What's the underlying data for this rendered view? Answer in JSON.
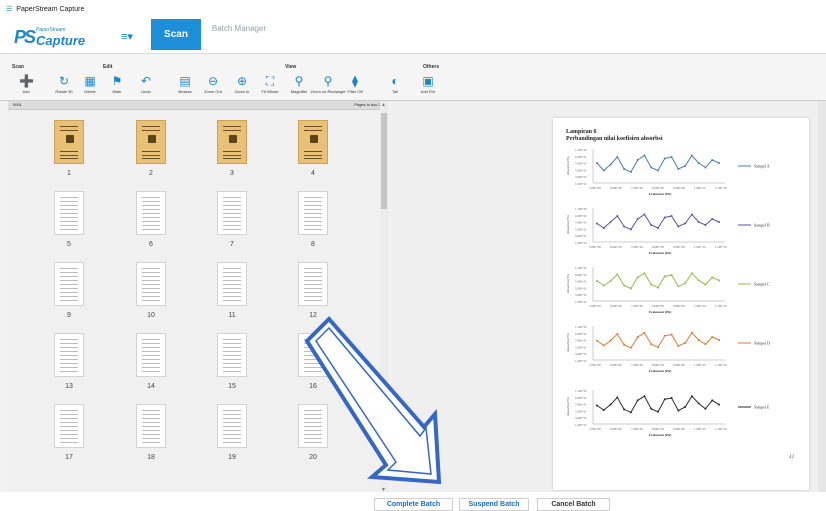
{
  "window": {
    "title": "PaperStream Capture"
  },
  "header": {
    "logo_small": "PaperStream",
    "logo_big": "Capture",
    "scan_label": "Scan",
    "batch_manager_label": "Batch Manager"
  },
  "ribbon": {
    "groups": [
      "Scan",
      "Edit",
      "View",
      "Others"
    ],
    "tools": [
      "Add",
      "Rotate 90",
      "Delete",
      "Mark",
      "Undo",
      "Browse",
      "Zoom Out",
      "Zoom In",
      "Fit Whole",
      "Magnifier",
      "Zoom on Rectangle",
      "Filter Off",
      "Tail",
      "Add File"
    ]
  },
  "thumbnails": {
    "header_left": "0001",
    "header_right": "Pages in doc 20",
    "pages": [
      "1",
      "2",
      "3",
      "4",
      "5",
      "6",
      "7",
      "8",
      "9",
      "10",
      "11",
      "12",
      "13",
      "14",
      "15",
      "16",
      "17",
      "18",
      "19",
      "20"
    ]
  },
  "document": {
    "line1": "Lampiran 6",
    "line2": "Perbandingan nilai koefisien absorbsi",
    "page_number": "42",
    "ylabel": "Absorbsi (%)",
    "xlabel": "Frekuensi (Hz)",
    "xticks": [
      "5.00E+09",
      "6.00E+09",
      "7.00E+09",
      "8.00E+09",
      "9.00E+09",
      "1.00E+10",
      "1.10E+10"
    ],
    "yticks": [
      "1.10E+02",
      "9.00E+01",
      "7.00E+01",
      "5.00E+01",
      "3.00E+01",
      "1.00E+01"
    ]
  },
  "chart_data": [
    {
      "type": "line",
      "series": [
        {
          "name": "Sampel A",
          "color": "#4a7fb5",
          "values": [
            60,
            35,
            55,
            80,
            40,
            30,
            70,
            85,
            45,
            35,
            75,
            80,
            40,
            50,
            85,
            60,
            45,
            70,
            60
          ]
        }
      ]
    },
    {
      "type": "line",
      "series": [
        {
          "name": "Sampel B",
          "color": "#5a54a6",
          "values": [
            55,
            40,
            60,
            80,
            45,
            35,
            70,
            85,
            50,
            40,
            75,
            80,
            45,
            55,
            85,
            60,
            50,
            70,
            60
          ]
        }
      ]
    },
    {
      "type": "line",
      "series": [
        {
          "name": "Sampel C",
          "color": "#8fbd4c",
          "values": [
            60,
            45,
            60,
            82,
            45,
            35,
            72,
            86,
            48,
            38,
            76,
            80,
            42,
            52,
            86,
            62,
            48,
            72,
            62
          ]
        }
      ]
    },
    {
      "type": "line",
      "series": [
        {
          "name": "Sampel D",
          "color": "#e07b35",
          "values": [
            58,
            42,
            58,
            80,
            44,
            34,
            70,
            84,
            46,
            36,
            74,
            78,
            40,
            50,
            84,
            60,
            46,
            70,
            60
          ]
        }
      ]
    },
    {
      "type": "line",
      "series": [
        {
          "name": "Sampel E",
          "color": "#2b2b2b",
          "values": [
            55,
            40,
            58,
            82,
            42,
            32,
            72,
            86,
            44,
            34,
            76,
            80,
            38,
            50,
            86,
            62,
            44,
            72,
            58
          ]
        }
      ]
    }
  ],
  "footer": {
    "complete_label": "Complete Batch",
    "suspend_label": "Suspend Batch",
    "cancel_label": "Cancel Batch"
  }
}
